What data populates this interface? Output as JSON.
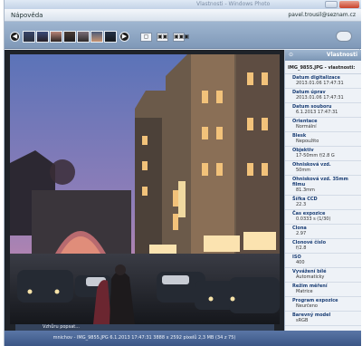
{
  "window": {
    "title": "Vlastnosti - Windows Photo",
    "user": "pavel.trousil@seznam.cz"
  },
  "menubar": {
    "section": "Nápověda"
  },
  "toolbar": {
    "prev_icon": "arrow-left-icon",
    "next_icon": "arrow-right-icon",
    "view_buttons": [
      "▢",
      "▣▣",
      "▣▣▣"
    ]
  },
  "photo": {
    "caption": "Vzhůru popsat..."
  },
  "properties": {
    "header": "Vlastnosti",
    "file_label": "IMG_9855.JPG - vlastnosti:",
    "items": [
      {
        "key": "Datum digitalizace",
        "value": "2013.01.06 17:47:31"
      },
      {
        "key": "Datum úprav",
        "value": "2013.01.06 17:47:31"
      },
      {
        "key": "Datum souboru",
        "value": "6.1.2013 17:47:31"
      },
      {
        "key": "Orientace",
        "value": "Normální"
      },
      {
        "key": "Blesk",
        "value": "Nepoužito"
      },
      {
        "key": "Objektiv",
        "value": "17-50mm f/2.8 G"
      },
      {
        "key": "Ohnisková vzd.",
        "value": "50mm"
      },
      {
        "key": "Ohnisková vzd. 35mm filmu",
        "value": "81.3mm"
      },
      {
        "key": "Šířka CCD",
        "value": "22.3"
      },
      {
        "key": "Čas expozice",
        "value": "0.0333 s (1/30)"
      },
      {
        "key": "Clona",
        "value": "2.97"
      },
      {
        "key": "Clonové číslo",
        "value": "f/2.8"
      },
      {
        "key": "ISO",
        "value": "400"
      },
      {
        "key": "Vyvážení bílé",
        "value": "Automaticky"
      },
      {
        "key": "Režim měření",
        "value": "Matrice"
      },
      {
        "key": "Program expozice",
        "value": "Neurčeno"
      },
      {
        "key": "Barevný model",
        "value": "sRGB"
      }
    ]
  },
  "statusbar": {
    "text": "mnichov - IMG_9855.JPG    6.1.2013 17:47:31    3888 x 2592 pixelů    2,3 MB    (34 z 75)"
  },
  "colors": {
    "accent": "#7f99b8",
    "status": "#3b5685",
    "props_bg": "#eef2f7",
    "sky_top": "#5b73b8",
    "sky_bottom": "#d98aa8"
  }
}
